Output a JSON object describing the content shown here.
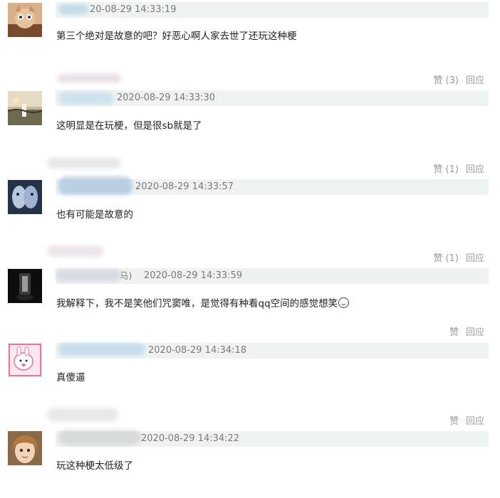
{
  "comments": [
    {
      "name_fragment": "",
      "timestamp": "20-08-29 14:33:19",
      "text": "第三个绝对是故意的吧？好恶心啊人家去世了还玩这种梗",
      "likes": "赞 (3)",
      "reply": "回应"
    },
    {
      "name_fragment": "",
      "timestamp": "2020-08-29 14:33:30",
      "text": "这明显是在玩梗，但是很sb就是了",
      "likes": "赞 (1)",
      "reply": "回应"
    },
    {
      "name_fragment": "",
      "timestamp": "2020-08-29 14:33:57",
      "text": "也有可能是故意的",
      "likes": "赞 (1)",
      "reply": "回应"
    },
    {
      "name_fragment": "马)",
      "timestamp": "2020-08-29 14:33:59",
      "text": "我解释下，我不是笑他们咒窦唯，是觉得有种看qq空间的感觉想笑",
      "likes": "赞",
      "reply": "回应"
    },
    {
      "name_fragment": "",
      "timestamp": "2020-08-29 14:34:18",
      "text": "真傻逼",
      "likes": "赞",
      "reply": "回应"
    },
    {
      "name_fragment": "",
      "timestamp": "2020-08-29 14:34:22",
      "text": "玩这种梗太低级了",
      "likes": "",
      "reply": ""
    }
  ]
}
